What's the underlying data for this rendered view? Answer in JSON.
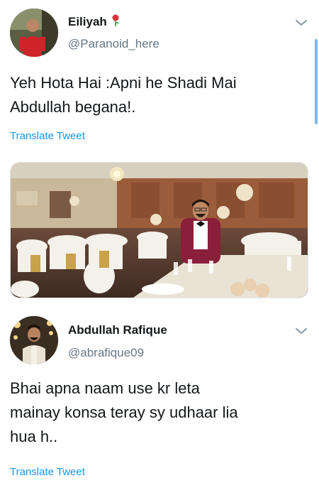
{
  "tweets": [
    {
      "display_name": "Eiliyah",
      "handle": "@Paranoid_here",
      "text": "Yeh Hota Hai :Apni he Shadi Mai\nAbdullah begana!.",
      "translate_label": "Translate Tweet",
      "badge_icon": "rose-icon"
    },
    {
      "display_name": "Abdullah Rafique",
      "handle": "@abrafique09",
      "text": "Bhai apna naam use kr leta\nmainay konsa teray sy udhaar lia\nhua h..",
      "translate_label": "Translate Tweet"
    }
  ],
  "icons": {
    "menu": "chevron-down-icon"
  },
  "colors": {
    "link": "#1b95e0",
    "secondary_text": "#657786",
    "primary_text": "#14171a"
  }
}
